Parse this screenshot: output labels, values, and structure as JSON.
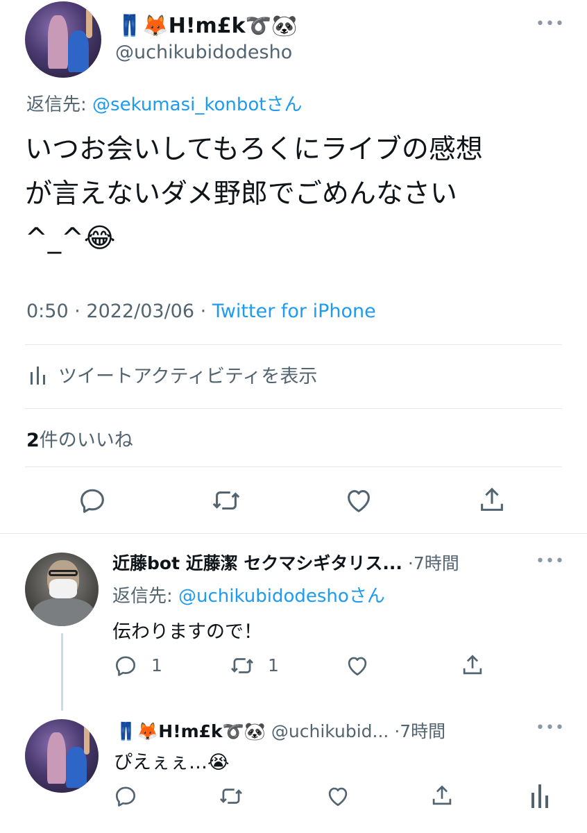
{
  "main_tweet": {
    "display_name_prefix": "👖🦊",
    "display_name_core": "H!m£k",
    "display_name_suffix": "➰🐼",
    "handle": "@uchikubidodesho",
    "reply_prefix": "返信先:",
    "reply_handle": "@sekumasi_konbot",
    "reply_suffix": "さん",
    "text_line1": "いつお会いしてもろくにライブの感想",
    "text_line2": "が言えないダメ野郎でごめんなさい",
    "text_line3": "^_^😂",
    "time": "0:50",
    "date": "2022/03/06",
    "source": "Twitter for iPhone",
    "activity_label": "ツイートアクティビティを表示",
    "likes_count": "2",
    "likes_label": "件のいいね"
  },
  "reply1": {
    "display_name": "近藤bot 近藤潔 セクマシギタリス...",
    "time": "7時間",
    "reply_prefix": "返信先:",
    "reply_handle": "@uchikubidodesho",
    "reply_suffix": "さん",
    "text": "伝わりますので！",
    "reply_count": "1",
    "retweet_count": "1"
  },
  "reply2": {
    "display_name_prefix": "👖🦊",
    "display_name_core": "H!m£k",
    "display_name_suffix": "➰🐼",
    "handle": "@uchikubid...",
    "time": "7時間",
    "text": "ぴえぇぇ…😭"
  },
  "separator": "·",
  "colors": {
    "link": "#1d9bf0",
    "secondary_text": "#536471",
    "icon": "#536471",
    "divider": "#e6e9ec"
  },
  "icons": [
    "reply-icon",
    "retweet-icon",
    "like-icon",
    "share-icon",
    "analytics-icon",
    "more-icon"
  ]
}
